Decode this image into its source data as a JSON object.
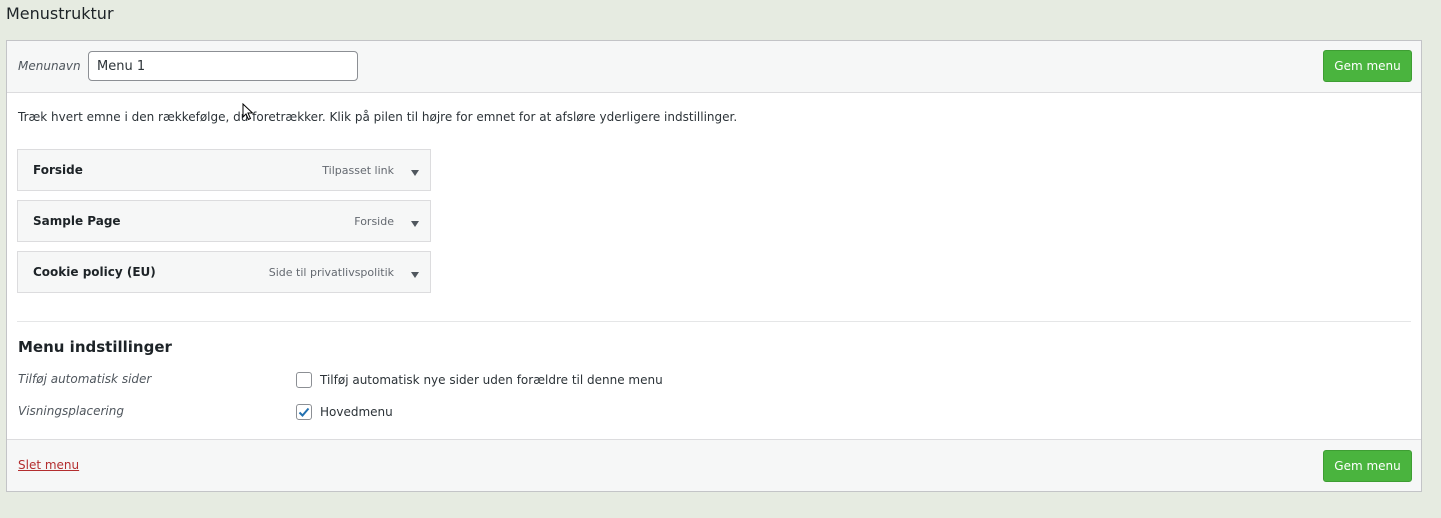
{
  "page": {
    "title": "Menustruktur"
  },
  "header": {
    "menu_name_label": "Menunavn",
    "menu_name_value": "Menu 1",
    "save_label": "Gem menu"
  },
  "instructions": "Træk hvert emne i den rækkefølge, du foretrækker. Klik på pilen til højre for emnet for at afsløre yderligere indstillinger.",
  "menu_items": [
    {
      "title": "Forside",
      "type": "Tilpasset link"
    },
    {
      "title": "Sample Page",
      "type": "Forside"
    },
    {
      "title": "Cookie policy (EU)",
      "type": "Side til privatlivspolitik"
    }
  ],
  "settings": {
    "title": "Menu indstillinger",
    "auto_add": {
      "label": "Tilføj automatisk sider",
      "text": "Tilføj automatisk nye sider uden forældre til denne menu",
      "checked": false
    },
    "display_location": {
      "label": "Visningsplacering",
      "text": "Hovedmenu",
      "checked": true
    }
  },
  "footer": {
    "delete_label": "Slet menu",
    "save_label": "Gem menu"
  },
  "colors": {
    "primary_button": "#4ab43e",
    "delete_link": "#b32d2e",
    "check_mark": "#2271b1"
  },
  "icons": {
    "item_toggle": "arrow-down-icon",
    "check": "checkmark-icon",
    "cursor": "mouse-pointer-icon"
  }
}
